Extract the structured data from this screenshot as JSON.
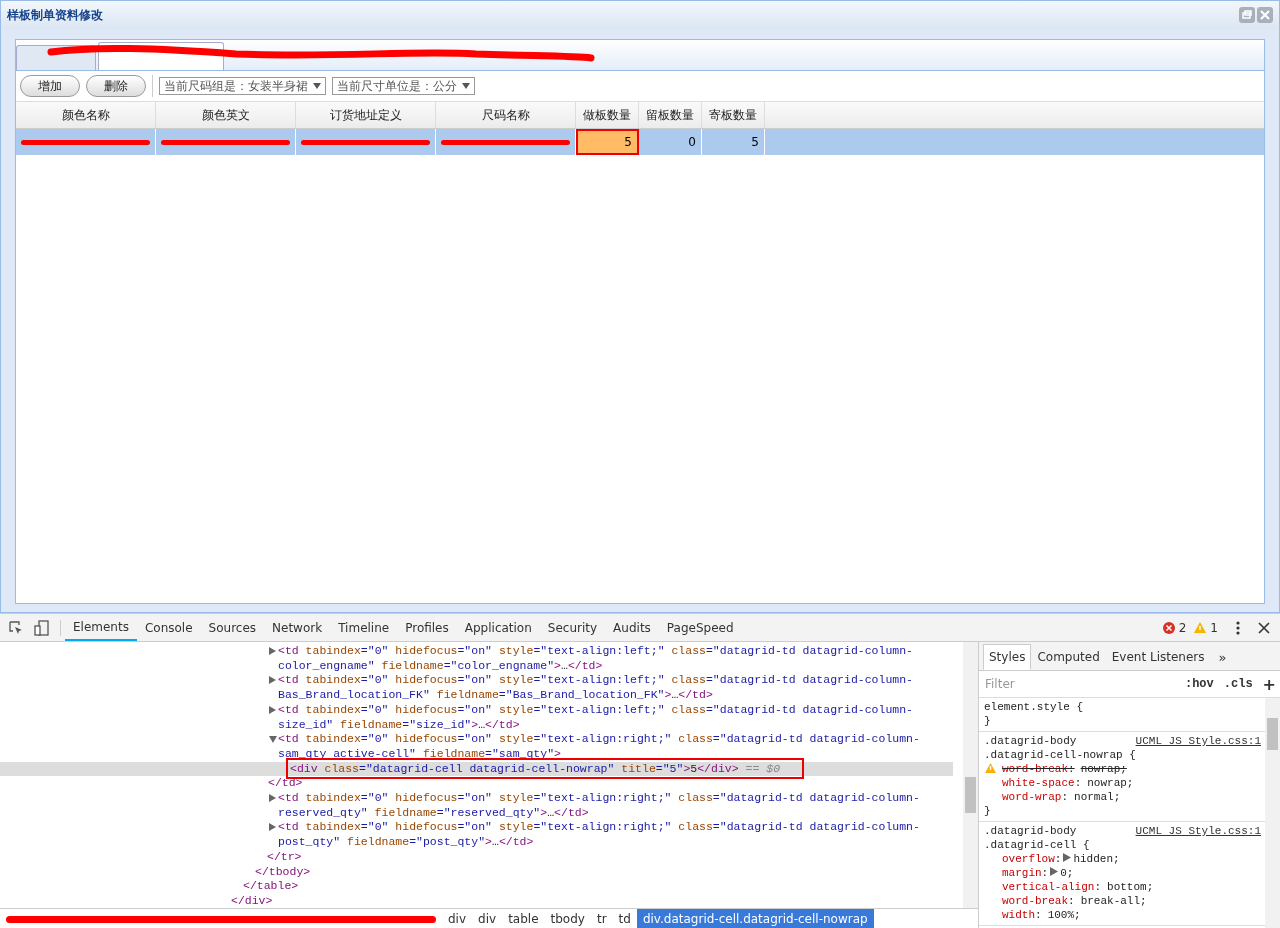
{
  "window": {
    "title": "样板制单资料修改"
  },
  "tabs": [
    {
      "selected": false
    },
    {
      "selected": true
    }
  ],
  "toolbar": {
    "buttons": [
      "增加",
      "删除"
    ],
    "dropdowns": [
      "当前尺码组是：女装半身裙",
      "当前尺寸单位是：公分"
    ]
  },
  "table": {
    "columns": [
      "颜色名称",
      "颜色英文",
      "订货地址定义",
      "尺码名称",
      "做板数量",
      "留板数量",
      "寄板数量"
    ],
    "rows": [
      {
        "selected": true,
        "cells": [
          {
            "redacted": true
          },
          {
            "redacted": true
          },
          {
            "redacted": true
          },
          {
            "redacted": true
          },
          {
            "text": "5",
            "active": true
          },
          {
            "text": "0",
            "active": false
          },
          {
            "text": "5",
            "active": false
          }
        ]
      }
    ]
  },
  "devtools": {
    "tabs": [
      {
        "label": "Elements",
        "selected": true
      },
      {
        "label": "Console",
        "selected": false
      },
      {
        "label": "Sources",
        "selected": false
      },
      {
        "label": "Network",
        "selected": false
      },
      {
        "label": "Timeline",
        "selected": false
      },
      {
        "label": "Profiles",
        "selected": false
      },
      {
        "label": "Application",
        "selected": false
      },
      {
        "label": "Security",
        "selected": false
      },
      {
        "label": "Audits",
        "selected": false
      },
      {
        "label": "PageSpeed",
        "selected": false
      }
    ],
    "errors": "2",
    "warnings": "1",
    "dom": [
      {
        "close": "</div>",
        "children": [
          {
            "close": "</table>",
            "children": [
              {
                "close": "</tbody>",
                "children": [
                  {
                    "close": "</tr>",
                    "children": [
                      {
                        "expanded": false,
                        "selected": false,
                        "tokens": [
                          {
                            "kind": "tag",
                            "text": "<td"
                          },
                          {
                            "kind": "attr",
                            "text": " tabindex"
                          },
                          {
                            "kind": "val",
                            "text": "=\"0\""
                          },
                          {
                            "kind": "attr",
                            "text": " hidefocus"
                          },
                          {
                            "kind": "val",
                            "text": "=\"on\""
                          },
                          {
                            "kind": "attr",
                            "text": " style"
                          },
                          {
                            "kind": "val",
                            "text": "=\"text-align:left;\""
                          },
                          {
                            "kind": "attr",
                            "text": " class"
                          },
                          {
                            "kind": "val",
                            "text": "=\"datagrid-td datagrid-column-color_engname\""
                          },
                          {
                            "kind": "attr",
                            "text": " fieldname"
                          },
                          {
                            "kind": "val",
                            "text": "=\"color_engname\""
                          },
                          {
                            "kind": "tag",
                            "text": ">"
                          },
                          {
                            "kind": "txt",
                            "text": "…"
                          },
                          {
                            "kind": "tag",
                            "text": "</td>"
                          }
                        ]
                      },
                      {
                        "expanded": false,
                        "selected": false,
                        "tokens": [
                          {
                            "kind": "tag",
                            "text": "<td"
                          },
                          {
                            "kind": "attr",
                            "text": " tabindex"
                          },
                          {
                            "kind": "val",
                            "text": "=\"0\""
                          },
                          {
                            "kind": "attr",
                            "text": " hidefocus"
                          },
                          {
                            "kind": "val",
                            "text": "=\"on\""
                          },
                          {
                            "kind": "attr",
                            "text": " style"
                          },
                          {
                            "kind": "val",
                            "text": "=\"text-align:left;\""
                          },
                          {
                            "kind": "attr",
                            "text": " class"
                          },
                          {
                            "kind": "val",
                            "text": "=\"datagrid-td datagrid-column-Bas_Brand_location_FK\""
                          },
                          {
                            "kind": "attr",
                            "text": " fieldname"
                          },
                          {
                            "kind": "val",
                            "text": "=\"Bas_Brand_location_FK\""
                          },
                          {
                            "kind": "tag",
                            "text": ">"
                          },
                          {
                            "kind": "txt",
                            "text": "…"
                          },
                          {
                            "kind": "tag",
                            "text": "</td>"
                          }
                        ]
                      },
                      {
                        "expanded": false,
                        "selected": false,
                        "tokens": [
                          {
                            "kind": "tag",
                            "text": "<td"
                          },
                          {
                            "kind": "attr",
                            "text": " tabindex"
                          },
                          {
                            "kind": "val",
                            "text": "=\"0\""
                          },
                          {
                            "kind": "attr",
                            "text": " hidefocus"
                          },
                          {
                            "kind": "val",
                            "text": "=\"on\""
                          },
                          {
                            "kind": "attr",
                            "text": " style"
                          },
                          {
                            "kind": "val",
                            "text": "=\"text-align:left;\""
                          },
                          {
                            "kind": "attr",
                            "text": " class"
                          },
                          {
                            "kind": "val",
                            "text": "=\"datagrid-td datagrid-column-size_id\""
                          },
                          {
                            "kind": "attr",
                            "text": " fieldname"
                          },
                          {
                            "kind": "val",
                            "text": "=\"size_id\""
                          },
                          {
                            "kind": "tag",
                            "text": ">"
                          },
                          {
                            "kind": "txt",
                            "text": "…"
                          },
                          {
                            "kind": "tag",
                            "text": "</td>"
                          }
                        ]
                      },
                      {
                        "expanded": true,
                        "selected": false,
                        "close": "</td>",
                        "tokens": [
                          {
                            "kind": "tag",
                            "text": "<td"
                          },
                          {
                            "kind": "attr",
                            "text": " tabindex"
                          },
                          {
                            "kind": "val",
                            "text": "=\"0\""
                          },
                          {
                            "kind": "attr",
                            "text": " hidefocus"
                          },
                          {
                            "kind": "val",
                            "text": "=\"on\""
                          },
                          {
                            "kind": "attr",
                            "text": " style"
                          },
                          {
                            "kind": "val",
                            "text": "=\"text-align:right;\""
                          },
                          {
                            "kind": "attr",
                            "text": " class"
                          },
                          {
                            "kind": "val",
                            "text": "=\"datagrid-td datagrid-column-sam_qty active-cell\""
                          },
                          {
                            "kind": "attr",
                            "text": " fieldname"
                          },
                          {
                            "kind": "val",
                            "text": "=\"sam_qty\""
                          },
                          {
                            "kind": "tag",
                            "text": ">"
                          }
                        ],
                        "children": [
                          {
                            "selected": true,
                            "annotated": true,
                            "tokens": [
                              {
                                "kind": "tag",
                                "text": "<div"
                              },
                              {
                                "kind": "attr",
                                "text": " class"
                              },
                              {
                                "kind": "val",
                                "text": "=\"datagrid-cell datagrid-cell-nowrap\""
                              },
                              {
                                "kind": "attr",
                                "text": " title"
                              },
                              {
                                "kind": "val",
                                "text": "=\"5\""
                              },
                              {
                                "kind": "tag",
                                "text": ">"
                              },
                              {
                                "kind": "txt",
                                "text": "5"
                              },
                              {
                                "kind": "tag",
                                "text": "</div>"
                              },
                              {
                                "kind": "ref",
                                "text": " == $0"
                              }
                            ]
                          }
                        ]
                      },
                      {
                        "expanded": false,
                        "selected": false,
                        "tokens": [
                          {
                            "kind": "tag",
                            "text": "<td"
                          },
                          {
                            "kind": "attr",
                            "text": " tabindex"
                          },
                          {
                            "kind": "val",
                            "text": "=\"0\""
                          },
                          {
                            "kind": "attr",
                            "text": " hidefocus"
                          },
                          {
                            "kind": "val",
                            "text": "=\"on\""
                          },
                          {
                            "kind": "attr",
                            "text": " style"
                          },
                          {
                            "kind": "val",
                            "text": "=\"text-align:right;\""
                          },
                          {
                            "kind": "attr",
                            "text": " class"
                          },
                          {
                            "kind": "val",
                            "text": "=\"datagrid-td datagrid-column-reserved_qty\""
                          },
                          {
                            "kind": "attr",
                            "text": " fieldname"
                          },
                          {
                            "kind": "val",
                            "text": "=\"reserved_qty\""
                          },
                          {
                            "kind": "tag",
                            "text": ">"
                          },
                          {
                            "kind": "txt",
                            "text": "…"
                          },
                          {
                            "kind": "tag",
                            "text": "</td>"
                          }
                        ]
                      },
                      {
                        "expanded": false,
                        "selected": false,
                        "tokens": [
                          {
                            "kind": "tag",
                            "text": "<td"
                          },
                          {
                            "kind": "attr",
                            "text": " tabindex"
                          },
                          {
                            "kind": "val",
                            "text": "=\"0\""
                          },
                          {
                            "kind": "attr",
                            "text": " hidefocus"
                          },
                          {
                            "kind": "val",
                            "text": "=\"on\""
                          },
                          {
                            "kind": "attr",
                            "text": " style"
                          },
                          {
                            "kind": "val",
                            "text": "=\"text-align:right;\""
                          },
                          {
                            "kind": "attr",
                            "text": " class"
                          },
                          {
                            "kind": "val",
                            "text": "=\"datagrid-td datagrid-column-post_qty\""
                          },
                          {
                            "kind": "attr",
                            "text": " fieldname"
                          },
                          {
                            "kind": "val",
                            "text": "=\"post_qty\""
                          },
                          {
                            "kind": "tag",
                            "text": ">"
                          },
                          {
                            "kind": "txt",
                            "text": "…"
                          },
                          {
                            "kind": "tag",
                            "text": "</td>"
                          }
                        ]
                      }
                    ]
                  }
                ]
              }
            ]
          }
        ]
      }
    ],
    "breadcrumbs": [
      {
        "label": "div",
        "selected": false
      },
      {
        "label": "div",
        "selected": false
      },
      {
        "label": "table",
        "selected": false
      },
      {
        "label": "tbody",
        "selected": false
      },
      {
        "label": "tr",
        "selected": false
      },
      {
        "label": "td",
        "selected": false
      },
      {
        "label": "div.datagrid-cell.datagrid-cell-nowrap",
        "selected": true
      }
    ],
    "styles": {
      "tabs": [
        {
          "label": "Styles",
          "selected": true
        },
        {
          "label": "Computed",
          "selected": false
        },
        {
          "label": "Event Listeners",
          "selected": false
        }
      ],
      "more": "»",
      "filter": {
        "placeholder": "Filter"
      },
      "hov": ":hov",
      "cls": ".cls",
      "add": "+",
      "rules": [
        {
          "selectors": [
            "element.style {"
          ],
          "close": "}"
        },
        {
          "selectors": [
            ".datagrid-body",
            ".datagrid-cell-nowrap {"
          ],
          "source": "UCML JS Style.css:1",
          "close": "}",
          "decls": [
            {
              "prop": "word-break",
              "sep": ":",
              "value": "nowrap;",
              "struck": true,
              "warning": true,
              "expandable": false
            },
            {
              "prop": "white-space",
              "sep": ":",
              "value": "nowrap;",
              "struck": false,
              "warning": false,
              "expandable": false
            },
            {
              "prop": "word-wrap",
              "sep": ":",
              "value": "normal;",
              "struck": false,
              "warning": false,
              "expandable": false
            }
          ]
        },
        {
          "selectors": [
            ".datagrid-body",
            ".datagrid-cell {"
          ],
          "source": "UCML JS Style.css:1",
          "decls": [
            {
              "prop": "overflow",
              "sep": ":",
              "value": "hidden;",
              "struck": false,
              "warning": false,
              "expandable": true
            },
            {
              "prop": "margin",
              "sep": ":",
              "value": "0;",
              "struck": false,
              "warning": false,
              "expandable": true
            },
            {
              "prop": "vertical-align",
              "sep": ":",
              "value": "bottom;",
              "struck": false,
              "warning": false,
              "expandable": false
            },
            {
              "prop": "word-break",
              "sep": ":",
              "value": "break-all;",
              "struck": false,
              "warning": false,
              "expandable": false
            },
            {
              "prop": "width",
              "sep": ":",
              "value": "100%;",
              "struck": false,
              "warning": false,
              "expandable": false
            }
          ]
        }
      ]
    }
  }
}
